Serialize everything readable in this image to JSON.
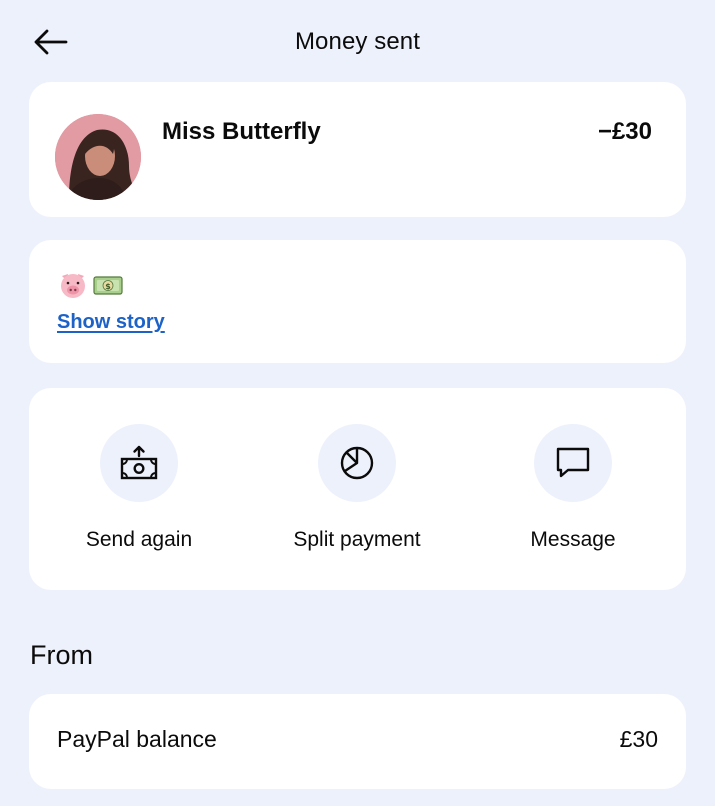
{
  "header": {
    "title": "Money sent",
    "back_icon": "back-arrow-icon"
  },
  "recipient": {
    "name": "Miss Butterfly",
    "amount": "−£30"
  },
  "story": {
    "emojis": [
      "🐷",
      "💵"
    ],
    "link_label": "Show story"
  },
  "actions": [
    {
      "label": "Send again",
      "icon": "send-money-icon"
    },
    {
      "label": "Split payment",
      "icon": "pie-chart-icon"
    },
    {
      "label": "Message",
      "icon": "message-icon"
    }
  ],
  "from": {
    "title": "From",
    "source": "PayPal balance",
    "amount": "£30"
  },
  "colors": {
    "background": "#edf1fb",
    "card": "#ffffff",
    "link": "#1d63c7"
  }
}
